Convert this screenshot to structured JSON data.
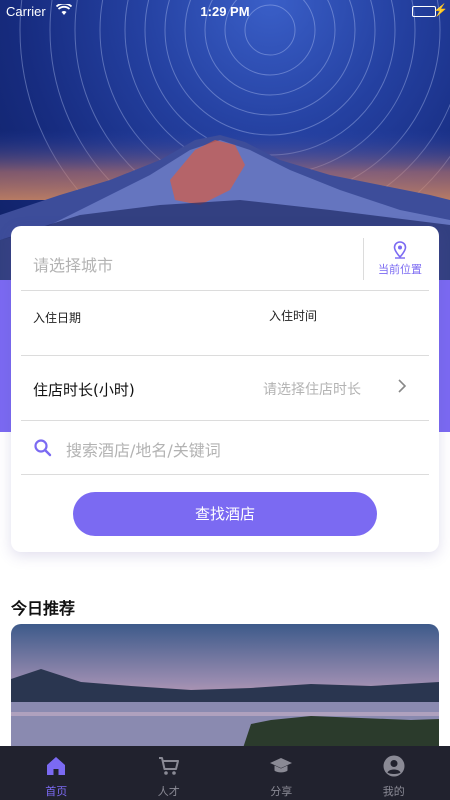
{
  "status_bar": {
    "carrier": "Carrier",
    "time": "1:29 PM"
  },
  "search_card": {
    "city_placeholder": "请选择城市",
    "current_location_label": "当前位置",
    "check_in_date_label": "入住日期",
    "check_in_time_label": "入住时间",
    "duration_label": "住店时长(小时)",
    "duration_placeholder": "请选择住店时长",
    "keyword_placeholder": "搜索酒店/地名/关键词",
    "find_button": "查找酒店"
  },
  "recommend": {
    "title": "今日推荐"
  },
  "tabs": [
    {
      "label": "首页",
      "icon": "home-icon",
      "active": true
    },
    {
      "label": "人才",
      "icon": "cart-icon",
      "active": false
    },
    {
      "label": "分享",
      "icon": "graduation-cap-icon",
      "active": false
    },
    {
      "label": "我的",
      "icon": "user-circle-icon",
      "active": false
    }
  ],
  "colors": {
    "accent": "#7b6af2",
    "tab_bar": "#21222e",
    "placeholder": "#b3b3b3"
  }
}
